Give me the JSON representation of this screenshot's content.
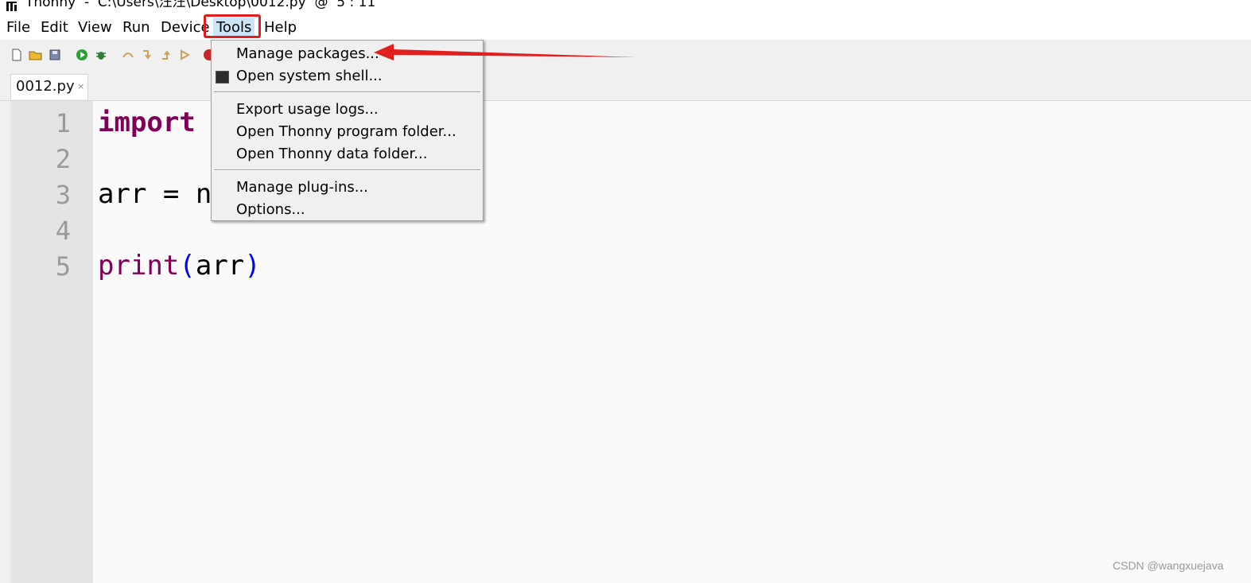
{
  "window": {
    "title": "Thonny  -  C:\\Users\\汪汪\\Desktop\\0012.py  @  5 : 11"
  },
  "menubar": {
    "items": [
      {
        "label": "File"
      },
      {
        "label": "Edit"
      },
      {
        "label": "View"
      },
      {
        "label": "Run"
      },
      {
        "label": "Device"
      },
      {
        "label": "Tools"
      },
      {
        "label": "Help"
      }
    ],
    "active": "Tools"
  },
  "tools_menu": {
    "items": [
      {
        "label": "Manage packages..."
      },
      {
        "label": "Open system shell..."
      },
      {
        "label": "Export usage logs..."
      },
      {
        "label": "Open Thonny program folder..."
      },
      {
        "label": "Open Thonny data folder..."
      },
      {
        "label": "Manage plug-ins..."
      },
      {
        "label": "Options..."
      }
    ]
  },
  "editor": {
    "tab_label": "0012.py",
    "tab_close": "×",
    "line_numbers": [
      "1",
      "2",
      "3",
      "4",
      "5"
    ],
    "code": {
      "line1_keyword": "import",
      "line3_text": "arr = n",
      "line5_func": "print",
      "line5_open": "(",
      "line5_arg": "arr",
      "line5_close": ")"
    }
  },
  "annotation": {
    "highlight_color": "#e02020"
  },
  "watermark": "CSDN @wangxuejava"
}
